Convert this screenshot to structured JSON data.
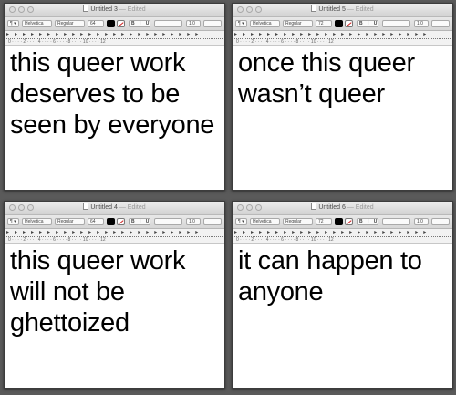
{
  "windows": [
    {
      "title": "Untitled 3",
      "status": "— Edited",
      "font": "Helvetica",
      "style": "Regular",
      "size": "64",
      "spacing": "1.0",
      "text": "this queer work deserves to be seen by everyone"
    },
    {
      "title": "Untitled 5",
      "status": "— Edited",
      "font": "Helvetica",
      "style": "Regular",
      "size": "72",
      "spacing": "1.0",
      "text": "once this queer wasn’t queer"
    },
    {
      "title": "Untitled 4",
      "status": "— Edited",
      "font": "Helvetica",
      "style": "Regular",
      "size": "64",
      "spacing": "1.0",
      "text": "this queer work will not be ghettoized"
    },
    {
      "title": "Untitled 6",
      "status": "— Edited",
      "font": "Helvetica",
      "style": "Regular",
      "size": "72",
      "spacing": "1.0",
      "text": "it can happen to anyone"
    }
  ],
  "toolbar": {
    "paragraph": "¶ ▾",
    "bold_italic_underline": "B I U"
  },
  "ruler": {
    "tabstops": "▸▸▸▸▸▸▸▸▸▸▸▸▸▸▸▸▸▸▸▸▸▸▸▸",
    "numbers": "0 · · · · 2 · · · · 4 · · · · 6 · · · · 8 · · · · 10 · · · · 12"
  },
  "colors": {
    "desktop": "#5a5a5a",
    "text": "#000000",
    "window": "#ffffff"
  },
  "icons": [
    "close-light",
    "minimize-light",
    "zoom-light",
    "document-icon",
    "text-color-swatch",
    "highlight-color-swatch",
    "tab-stop-marker"
  ]
}
